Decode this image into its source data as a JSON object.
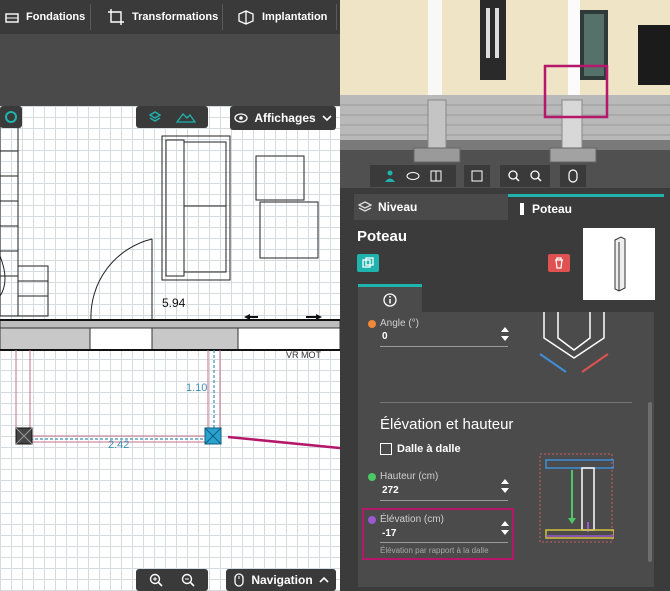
{
  "toolbar": {
    "items": [
      {
        "label": "Fondations",
        "icon": "fondations-icon"
      },
      {
        "label": "Transformations",
        "icon": "transform-icon"
      },
      {
        "label": "Implantation",
        "icon": "implantation-icon"
      }
    ]
  },
  "plan": {
    "display_button": "Affichages",
    "navigation_button": "Navigation",
    "dimension_wall": "5.94",
    "dimension_vertical": "1.10",
    "dimension_horizontal": "2.42",
    "wall_label": "VR MOT"
  },
  "panel": {
    "tabs": [
      {
        "label": "Niveau",
        "icon": "level-icon"
      },
      {
        "label": "Poteau",
        "icon": "column-icon"
      }
    ],
    "title": "Poteau",
    "angle_label": "Angle (°)",
    "angle_value": "0",
    "section_title": "Élévation et hauteur",
    "slab_checkbox_label": "Dalle à dalle",
    "height_label": "Hauteur (cm)",
    "height_value": "272",
    "elevation_label": "Élévation (cm)",
    "elevation_value": "-17",
    "elevation_help": "Élévation par rapport à la dalle"
  },
  "colors": {
    "accent_teal": "#1fb3ad",
    "delete_red": "#e05252",
    "highlight_magenta": "#b5176b",
    "height_green": "#4cc864",
    "elevation_purple": "#9b59d0",
    "angle_orange": "#f0883a"
  }
}
